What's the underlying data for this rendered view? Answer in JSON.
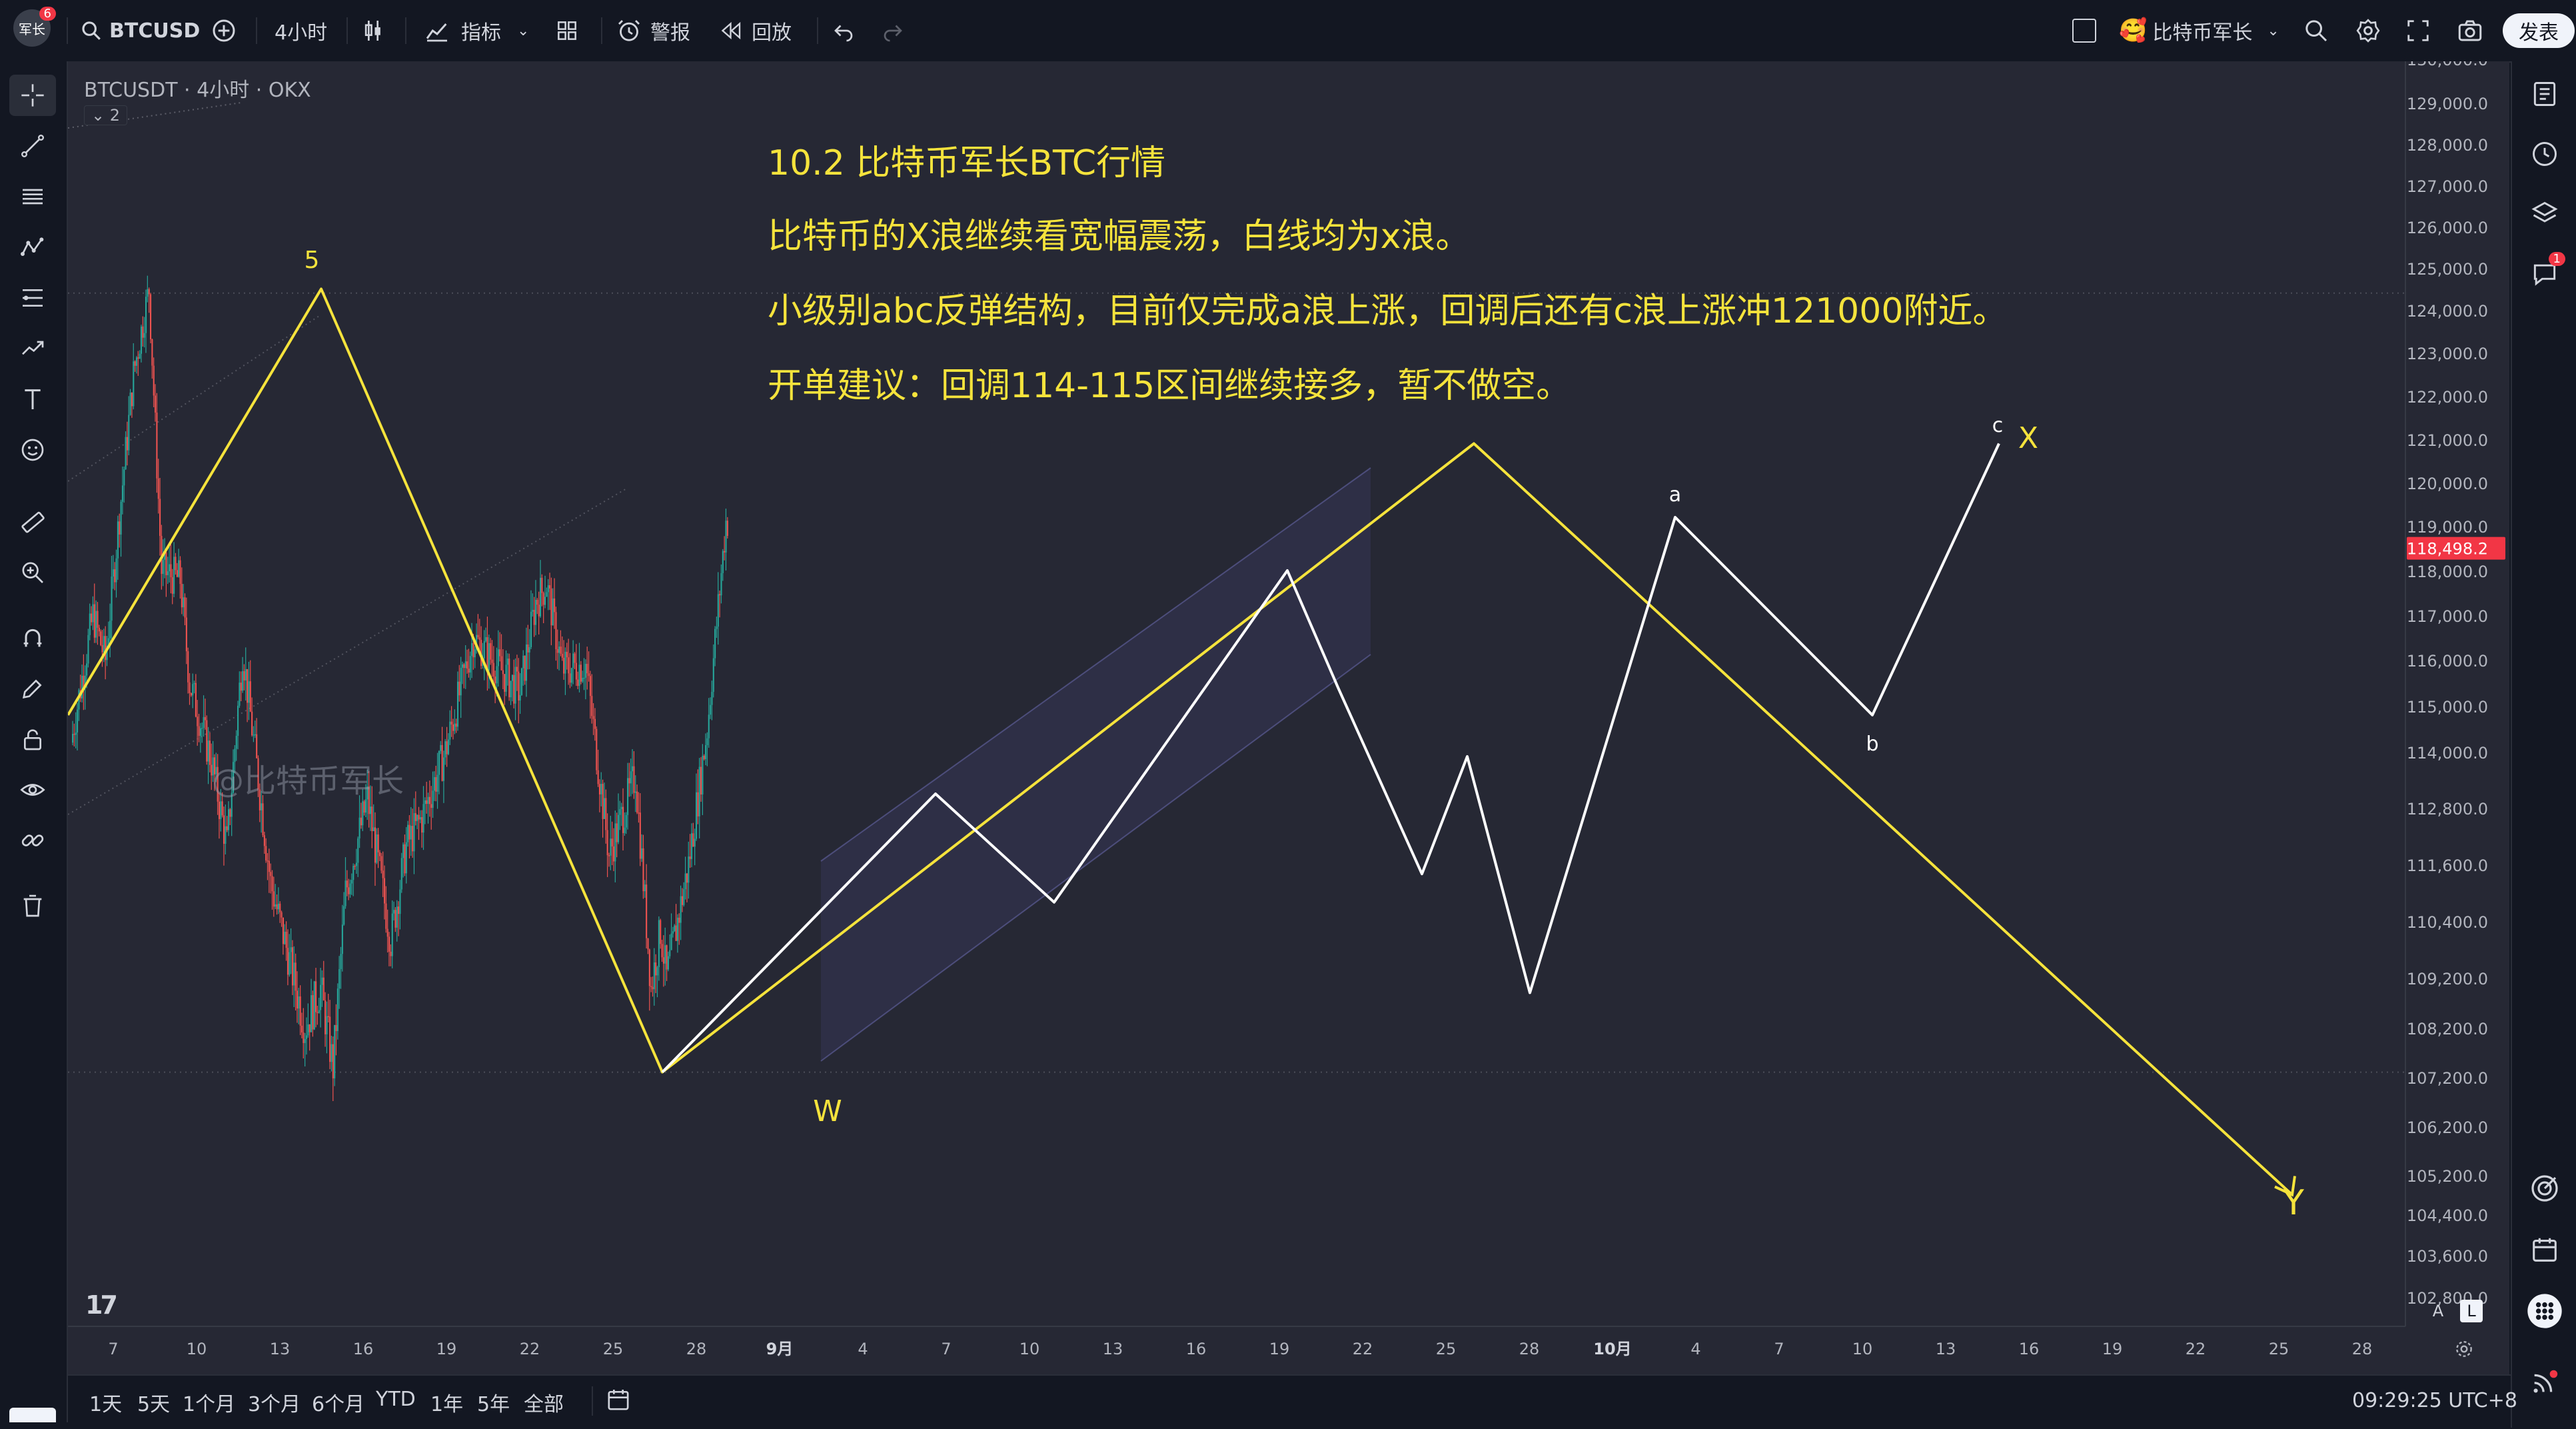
{
  "header": {
    "avatar_text": "军长",
    "avatar_badge": "6",
    "symbol": "BTCUSD",
    "interval": "4小时",
    "indicators_label": "指标",
    "alerts_label": "警报",
    "replay_label": "回放",
    "account_name": "比特币军长",
    "publish_label": "发表"
  },
  "legend": {
    "title": "BTCUSDT · 4小时 · OKX",
    "collapse_count": "2"
  },
  "annotation": {
    "line1": "10.2 比特币军长BTC行情",
    "line2": "比特币的X浪继续看宽幅震荡，白线均为x浪。",
    "line3": "小级别abc反弹结构，目前仅完成a浪上涨，回调后还有c浪上涨冲121000附近。",
    "line4": "开单建议：回调114-115区间继续接多，暂不做空。"
  },
  "watermark": "@比特币军长",
  "wave_labels": {
    "five": "5",
    "w": "W",
    "a": "a",
    "b": "b",
    "c": "c",
    "x": "X",
    "y": "Y"
  },
  "price_axis": {
    "top_partial": "130,000.0",
    "bottom_partial": "102,800.0",
    "ticks": [
      "129,000.0",
      "128,000.0",
      "127,000.0",
      "126,000.0",
      "125,000.0",
      "124,000.0",
      "123,000.0",
      "122,000.0",
      "121,000.0",
      "120,000.0",
      "119,000.0",
      "118,000.0",
      "117,000.0",
      "116,000.0",
      "115,000.0",
      "114,000.0",
      "112,800.0",
      "111,600.0",
      "110,400.0",
      "109,200.0",
      "108,200.0",
      "107,200.0",
      "106,200.0",
      "105,200.0",
      "104,400.0",
      "103,600.0"
    ],
    "current_price": "118,498.2"
  },
  "time_axis": [
    "7",
    "10",
    "13",
    "16",
    "19",
    "22",
    "25",
    "28",
    "9月",
    "4",
    "7",
    "10",
    "13",
    "16",
    "19",
    "22",
    "25",
    "28",
    "10月",
    "4",
    "7",
    "10",
    "13",
    "16",
    "19",
    "22",
    "25",
    "28"
  ],
  "scale_buttons": {
    "auto": "A",
    "log": "L"
  },
  "bottom": {
    "ranges": [
      "1天",
      "5天",
      "1个月",
      "3个月",
      "6个月",
      "YTD",
      "1年",
      "5年",
      "全部"
    ],
    "clock": "09:29:25 UTC+8"
  },
  "right_panel": {
    "notification_badge": "1"
  },
  "colors": {
    "background": "#131722",
    "chart_bg": "#262834",
    "up": "#26a69a",
    "down": "#ef5350",
    "annotation_text": "#f5e33c",
    "price_badge": "#f23645"
  },
  "chart_data": {
    "type": "candlestick",
    "symbol": "BTCUSDT",
    "interval": "4h",
    "exchange": "OKX",
    "y_range": [
      102800,
      130000
    ],
    "current_price": 118498.2,
    "yellow_wave_path": [
      {
        "label": "",
        "price": 114800
      },
      {
        "label": "5",
        "price": 124500
      },
      {
        "label": "W",
        "price": 107300
      },
      {
        "label": "X",
        "price": 120900
      },
      {
        "label": "Y",
        "price": 104800
      }
    ],
    "white_wave_path": [
      {
        "label": "",
        "price": 107300
      },
      {
        "label": "",
        "price": 113100
      },
      {
        "label": "",
        "price": 110800
      },
      {
        "label": "",
        "price": 118000
      },
      {
        "label": "",
        "price": 115400
      },
      {
        "label": "",
        "price": 111400
      },
      {
        "label": "",
        "price": 113900
      },
      {
        "label": "",
        "price": 108900
      },
      {
        "label": "a",
        "price": 119200
      },
      {
        "label": "b",
        "price": 114800
      },
      {
        "label": "c",
        "price": 120900
      }
    ]
  }
}
